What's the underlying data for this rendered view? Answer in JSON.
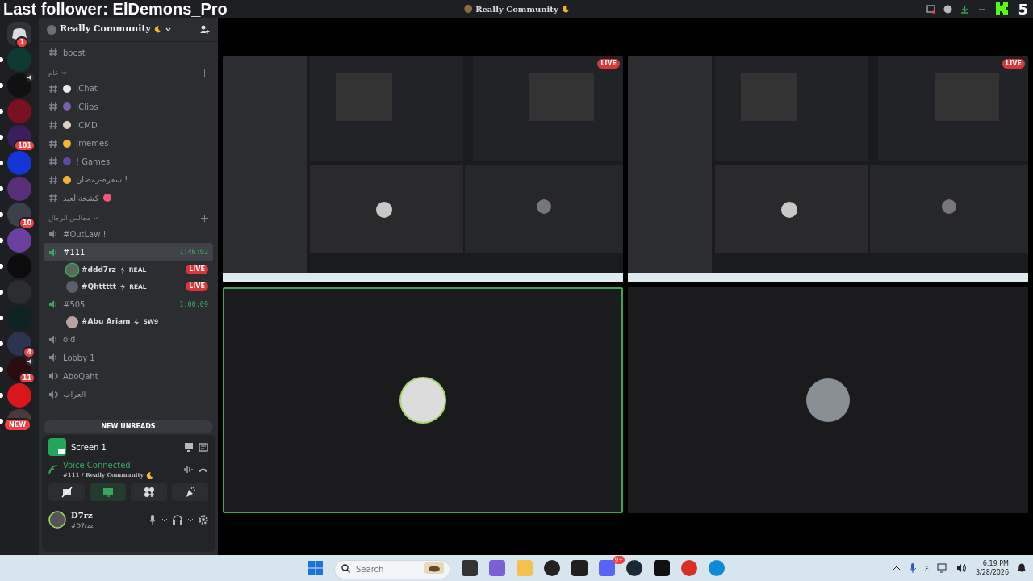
{
  "overlay": {
    "follower": "Last follower: ElDemons_Pro",
    "counter": "5"
  },
  "titlebar": {
    "title": "Really Community",
    "moon": true
  },
  "home": {
    "badge": "1"
  },
  "servers": [
    {
      "color": "#0d3b33",
      "unread": true
    },
    {
      "color": "#111111",
      "unread": true,
      "audio": true
    },
    {
      "color": "#7a1020",
      "unread": true
    },
    {
      "color": "#3a1f5c",
      "unread": true,
      "badge": "101"
    },
    {
      "color": "#1436d6",
      "unread": true
    },
    {
      "color": "#5a2f7a",
      "unread": true
    },
    {
      "color": "#3c4048",
      "unread": true,
      "badge": "10"
    },
    {
      "color": "#6b3fa0",
      "unread": true
    },
    {
      "color": "#0c0c0c",
      "unread": true
    },
    {
      "color": "#2b2d31",
      "unread": true
    },
    {
      "color": "#0e2424",
      "unread": true
    },
    {
      "color": "#2b3550",
      "unread": true,
      "badge": "4"
    },
    {
      "color": "#2a0c10",
      "unread": true,
      "audio": true,
      "badge": "11"
    },
    {
      "color": "#d8161c",
      "unread": true
    },
    {
      "color": "#4a3a3c",
      "unread": true,
      "badge": "NEW"
    }
  ],
  "server": {
    "name": "Really Community",
    "moon": true
  },
  "channels": [
    {
      "kind": "text",
      "name": "boost",
      "selected": false
    },
    {
      "kind": "category",
      "name": "عام",
      "expanded": true
    },
    {
      "kind": "text",
      "name": "|Chat",
      "color": "#e8e8f0",
      "selected": false
    },
    {
      "kind": "text",
      "name": "|Clips",
      "color": "#7a5fb0",
      "selected": false
    },
    {
      "kind": "text",
      "name": "|CMD",
      "color": "#d9d2c0",
      "selected": false
    },
    {
      "kind": "text",
      "name": "|memes",
      "color": "#f2b632",
      "selected": false
    },
    {
      "kind": "text",
      "name": "! Games",
      "color": "#5b4aa8",
      "selected": false
    },
    {
      "kind": "text",
      "name": "سفرة-رمضان !",
      "color": "#f2b632",
      "selected": false
    },
    {
      "kind": "text",
      "name": "كشخةالعيد",
      "color": "#f0567a",
      "emoji_after": true,
      "selected": false
    },
    {
      "kind": "category",
      "name": "مجالس الرجال",
      "expanded": true
    },
    {
      "kind": "voice",
      "name": "#OutLaw !",
      "active": false,
      "selected": false
    },
    {
      "kind": "voice",
      "name": "#111",
      "active": true,
      "selected": true,
      "timer": "1:46:02"
    },
    {
      "kind": "user",
      "name": "#ddd7rz",
      "tag": "REAL",
      "live": "LIVE",
      "speaking": true,
      "color": "#5a6a5a"
    },
    {
      "kind": "user",
      "name": "#Qhttttt",
      "tag": "REAL",
      "live": "LIVE",
      "speaking": false,
      "color": "#5a5f6c"
    },
    {
      "kind": "voice",
      "name": "#505",
      "active": true,
      "selected": false,
      "timer": "1:00:09"
    },
    {
      "kind": "user",
      "name": "#Abu Ariam",
      "tag": "SW9",
      "speaking": false,
      "color": "#b9a2a0"
    },
    {
      "kind": "voice",
      "name": "old",
      "active": false,
      "selected": false
    },
    {
      "kind": "voice",
      "name": "Lobby 1",
      "active": false,
      "selected": false
    },
    {
      "kind": "stage",
      "name": "AboQaht",
      "selected": false
    },
    {
      "kind": "stage",
      "name": "العراب",
      "selected": false
    }
  ],
  "new_unreads": "NEW UNREADS",
  "stream": {
    "name": "Screen 1"
  },
  "voice": {
    "status": "Voice Connected",
    "channel": "#111 / Really Community",
    "moon": true
  },
  "user": {
    "name": "D7rz",
    "tag": "#D7rzz"
  },
  "tiles": [
    {
      "kind": "stream",
      "live": "LIVE"
    },
    {
      "kind": "stream",
      "live": "LIVE"
    },
    {
      "kind": "avatar",
      "speaking": true,
      "color": "#dcdcdc"
    },
    {
      "kind": "avatar",
      "speaking": false,
      "color": "#8a8f96"
    }
  ],
  "taskbar": {
    "search": {
      "placeholder": "Search"
    },
    "discord_badge": "9+",
    "language": "ع",
    "time": "6:19 PM",
    "date": "3/28/2026"
  }
}
